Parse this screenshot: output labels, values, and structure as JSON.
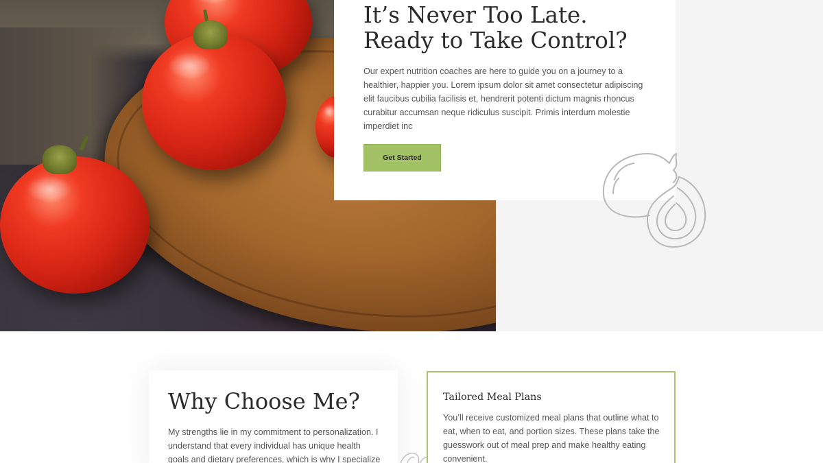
{
  "hero": {
    "title": "It’s Never Too Late. Ready to Take Control?",
    "body": "Our expert nutrition coaches are here to guide you on a journey to a healthier, happier you. Lorem ipsum dolor sit amet consectetur adipiscing elit faucibus cubilia facilisis et, hendrerit potenti dictum magnis rhoncus curabitur accumsan neque ridiculus suscipit. Primis interdum molestie imperdiet inc",
    "cta_label": "Get Started",
    "image": "tomatoes-on-cutting-board"
  },
  "why": {
    "title": "Why Choose Me?",
    "body": "My strengths lie in my commitment to personalization. I understand that every individual has unique health goals and dietary preferences, which is why I specialize"
  },
  "feature": {
    "title": "Tailored Meal Plans",
    "body": "You’ll receive customized meal plans that outline what to eat, when to eat, and portion sizes. These plans take the guesswork out of meal prep and make healthy eating convenient."
  },
  "decorations": {
    "hero_illustration": "onion-icon",
    "small_illustration": "leaf-sketch-icon"
  },
  "colors": {
    "accent": "#a3c165",
    "card_border": "#a8c46f",
    "heading": "#2b2b2b",
    "body_text": "#555555",
    "panel_bg": "#f4f4f4"
  }
}
